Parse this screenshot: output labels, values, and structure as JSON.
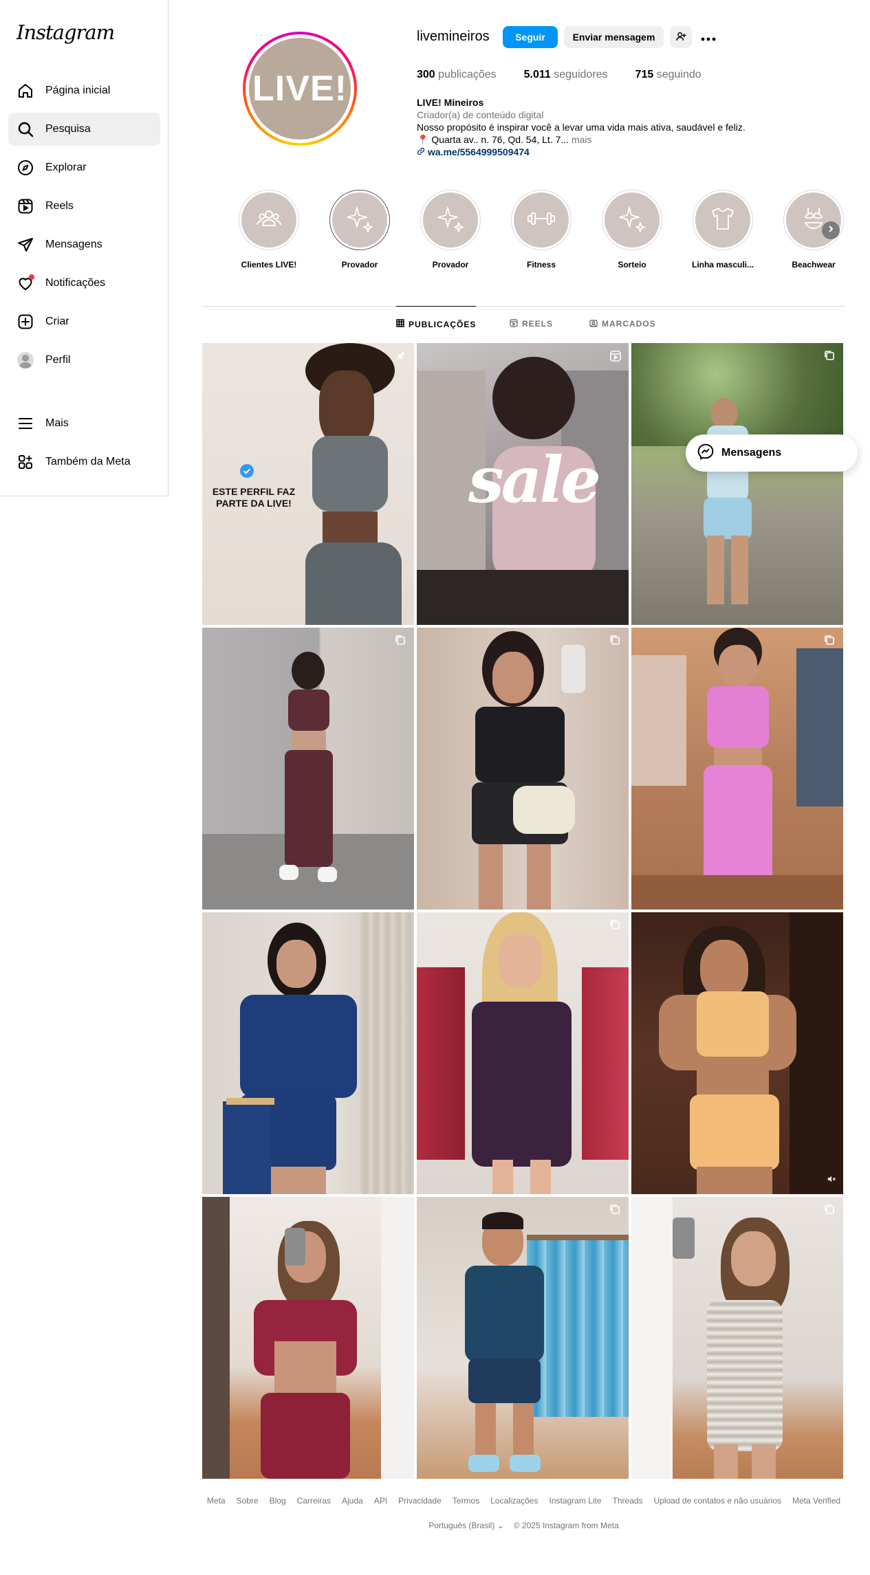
{
  "sidebar": {
    "logo": "Instagram",
    "items": [
      {
        "label": "Página inicial",
        "icon": "home-icon"
      },
      {
        "label": "Pesquisa",
        "icon": "search-icon"
      },
      {
        "label": "Explorar",
        "icon": "compass-icon"
      },
      {
        "label": "Reels",
        "icon": "reels-icon"
      },
      {
        "label": "Mensagens",
        "icon": "send-icon"
      },
      {
        "label": "Notificações",
        "icon": "heart-icon"
      },
      {
        "label": "Criar",
        "icon": "plus-square-icon"
      },
      {
        "label": "Perfil",
        "icon": "avatar-icon"
      }
    ],
    "lower": [
      {
        "label": "Mais",
        "icon": "menu-icon"
      },
      {
        "label": "Também da Meta",
        "icon": "meta-apps-icon"
      }
    ]
  },
  "profile": {
    "avatar_text": "LIVE!",
    "username": "livemineiros",
    "follow_label": "Seguir",
    "message_label": "Enviar mensagem",
    "stats": {
      "posts_value": "300",
      "posts_label": "publicações",
      "followers_value": "5.011",
      "followers_label": "seguidores",
      "following_value": "715",
      "following_label": "seguindo"
    },
    "full_name": "LIVE! Mineiros",
    "category": "Criador(a) de conteúdo digital",
    "bio_line": "Nosso propósito é inspirar você a levar uma vida mais ativa, saudável e feliz.",
    "address_line": "📍 Quarta av.. n. 76, Qd. 54, Lt. 7...",
    "more_label": "mais",
    "link": "wa.me/5564999509474"
  },
  "highlights": [
    {
      "label": "Clientes LIVE!",
      "icon": "people-icon"
    },
    {
      "label": "Provador",
      "icon": "sparkle-icon"
    },
    {
      "label": "Provador",
      "icon": "sparkle-icon"
    },
    {
      "label": "Fitness",
      "icon": "dumbbell-icon"
    },
    {
      "label": "Sorteio",
      "icon": "sparkle-icon"
    },
    {
      "label": "Linha masculi...",
      "icon": "tshirt-icon"
    },
    {
      "label": "Beachwear",
      "icon": "bikini-icon"
    }
  ],
  "tabs": [
    {
      "label": "PUBLICAÇÕES"
    },
    {
      "label": "REELS"
    },
    {
      "label": "MARCADOS"
    }
  ],
  "posts": {
    "post1_text": "ESTE PERFIL FAZ PARTE DA LIVE!",
    "post2_text": "sale"
  },
  "floating": {
    "label": "Mensagens"
  },
  "footer": {
    "links": [
      "Meta",
      "Sobre",
      "Blog",
      "Carreiras",
      "Ajuda",
      "API",
      "Privacidade",
      "Termos",
      "Localizações",
      "Instagram Lite",
      "Threads",
      "Upload de contatos e não usuários",
      "Meta Verified"
    ],
    "language": "Português (Brasil)",
    "copyright": "© 2025 Instagram from Meta"
  },
  "colors": {
    "accent": "#0095f6",
    "link": "#00376b",
    "highlight_bg": "#cfc4bf",
    "avatar_bg": "#b8a99a",
    "notification": "#ff3040"
  }
}
